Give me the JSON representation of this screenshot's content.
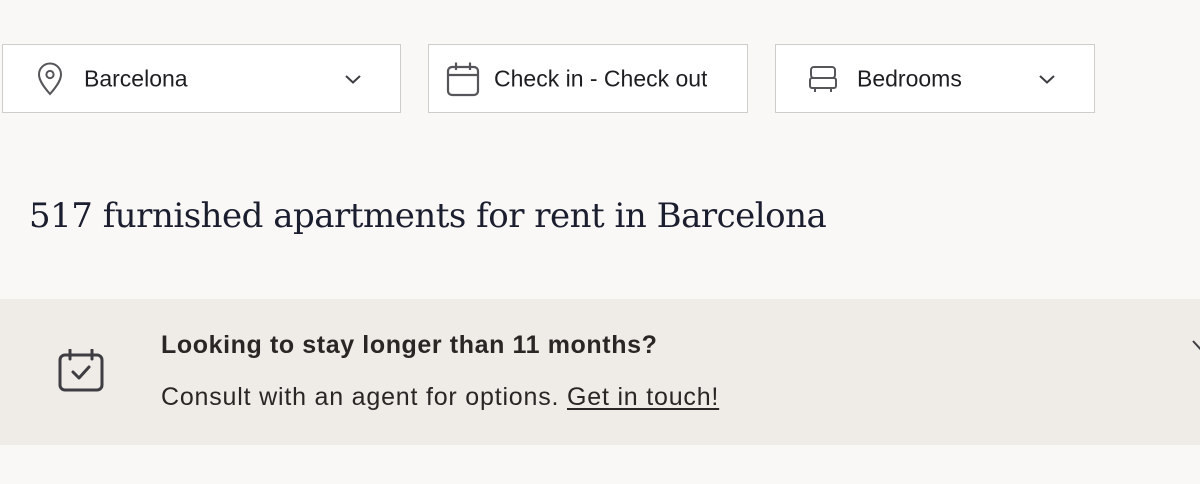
{
  "filters": {
    "location": {
      "value": "Barcelona",
      "icon": "map-pin-icon",
      "dropdown_icon": "chevron-down-icon"
    },
    "dates": {
      "value": "Check in - Check out",
      "icon": "calendar-icon"
    },
    "bedrooms": {
      "value": "Bedrooms",
      "icon": "bed-icon",
      "dropdown_icon": "chevron-down-icon"
    }
  },
  "results": {
    "heading": "517 furnished apartments for rent in Barcelona"
  },
  "banner": {
    "icon": "calendar-check-icon",
    "title": "Looking to stay longer than 11 months?",
    "text": "Consult with an agent for options. ",
    "link_text": "Get in touch!",
    "close_icon": "close-icon"
  },
  "colors": {
    "page_background": "#f9f8f6",
    "banner_background": "#efebe6",
    "filter_border": "#cfcdca",
    "heading_text": "#1b1e2e",
    "body_text": "#2a2626"
  }
}
